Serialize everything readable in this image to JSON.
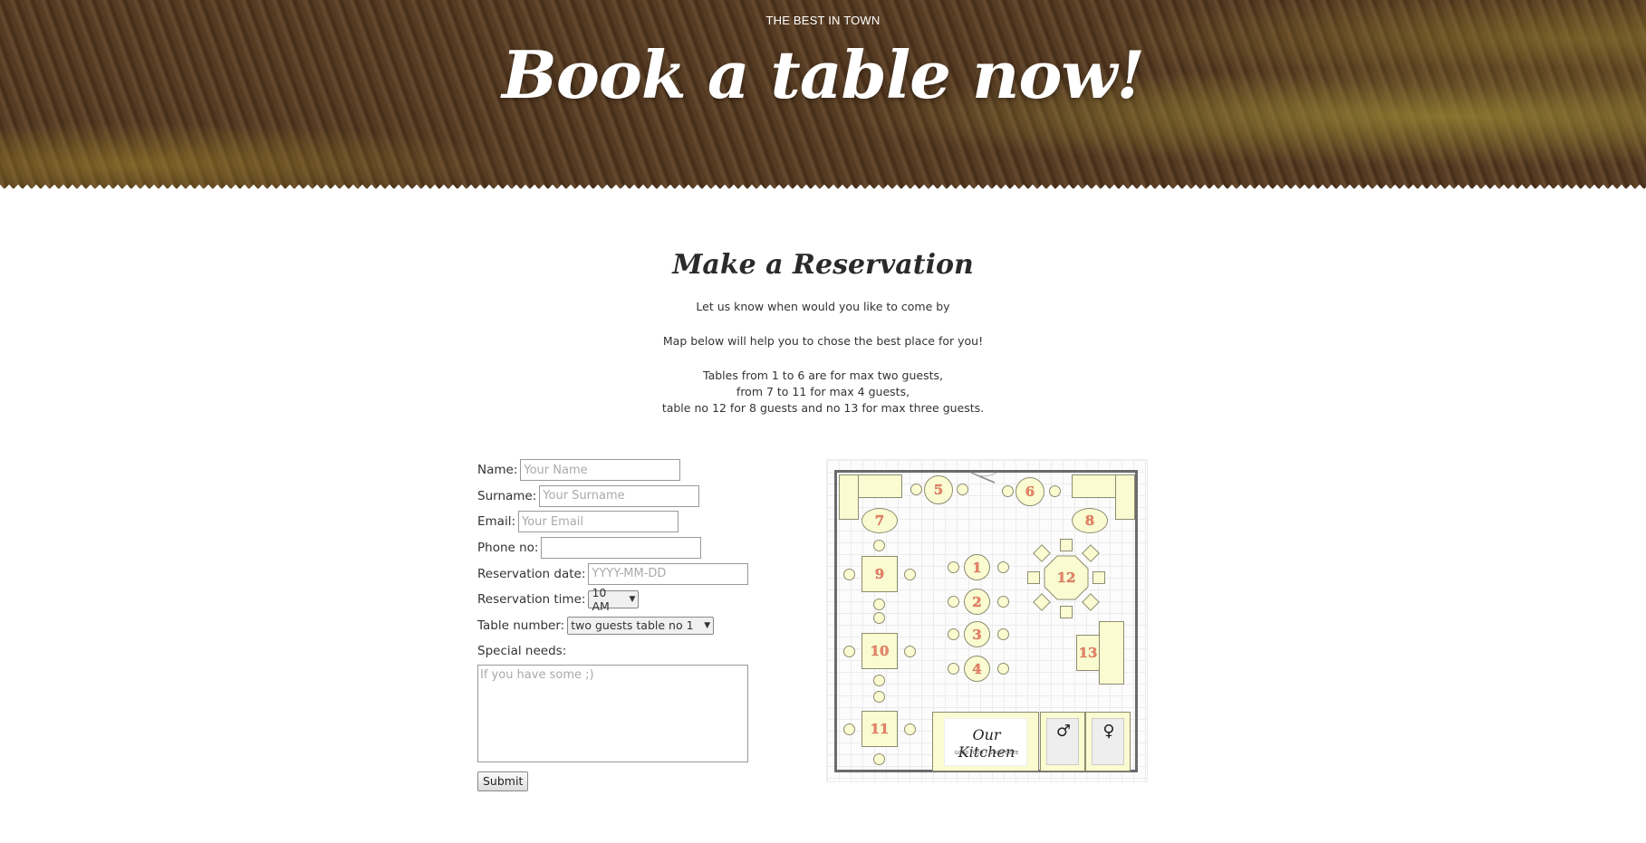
{
  "hero": {
    "kicker": "THE BEST IN TOWN",
    "title": "Book a table now!"
  },
  "reservation": {
    "title": "Make a Reservation",
    "line1": "Let us know when would you like to come by",
    "line2": "Map below will help you to chose the best place for you!",
    "line3a": "Tables from 1 to 6 are for max two guests,",
    "line3b": "from 7 to 11 for max 4 guests,",
    "line3c": "table no 12 for 8 guests and no 13 for max three guests."
  },
  "form": {
    "name_label": "Name:",
    "name_placeholder": "Your Name",
    "surname_label": "Surname:",
    "surname_placeholder": "Your Surname",
    "email_label": "Email:",
    "email_placeholder": "Your Email",
    "phone_label": "Phone no:",
    "phone_value": "",
    "date_label": "Reservation date:",
    "date_placeholder": "YYYY-MM-DD",
    "time_label": "Reservation time:",
    "time_selected": "10 AM",
    "table_label": "Table number:",
    "table_selected": "two guests table no 1",
    "special_label": "Special needs:",
    "special_placeholder": "If you have some ;)",
    "submit_label": "Submit"
  },
  "map": {
    "tables": [
      "1",
      "2",
      "3",
      "4",
      "5",
      "6",
      "7",
      "8",
      "9",
      "10",
      "11",
      "12",
      "13"
    ],
    "kitchen_title": "Our Kitchen",
    "kitchen_tagline": "GOOD FOOD • GOOD TASTE",
    "male_symbol": "♂",
    "female_symbol": "♀"
  }
}
